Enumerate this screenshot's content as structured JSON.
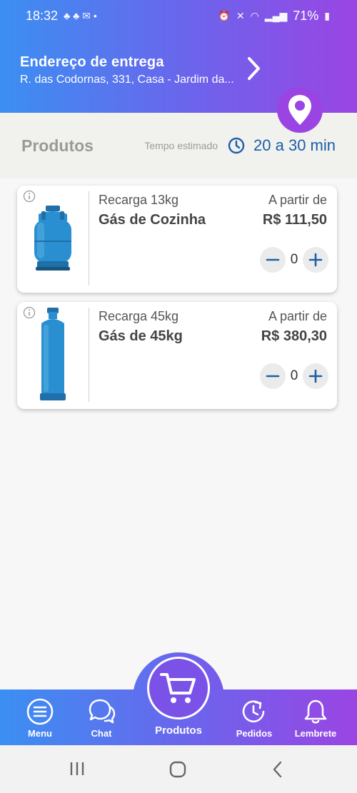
{
  "status_bar": {
    "time": "18:32",
    "battery": "71%"
  },
  "header": {
    "address_title": "Endereço de entrega",
    "address_text": "R. das Codornas, 331, Casa - Jardim da..."
  },
  "products_bar": {
    "title": "Produtos",
    "eta_label": "Tempo estimado",
    "eta_value": "20 a 30 min"
  },
  "products": [
    {
      "subtitle": "Recarga 13kg",
      "name": "Gás de Cozinha",
      "from_label": "A partir de",
      "price": "R$ 111,50",
      "quantity": "0"
    },
    {
      "subtitle": "Recarga 45kg",
      "name": "Gás de 45kg",
      "from_label": "A partir de",
      "price": "R$ 380,30",
      "quantity": "0"
    }
  ],
  "bottom_nav": {
    "menu": "Menu",
    "chat": "Chat",
    "produtos": "Produtos",
    "pedidos": "Pedidos",
    "lembrete": "Lembrete"
  },
  "colors": {
    "gradient_start": "#3b8ff2",
    "gradient_end": "#9a45e3",
    "accent_blue": "#1d5fa8",
    "cylinder_blue": "#2a8fd0"
  }
}
